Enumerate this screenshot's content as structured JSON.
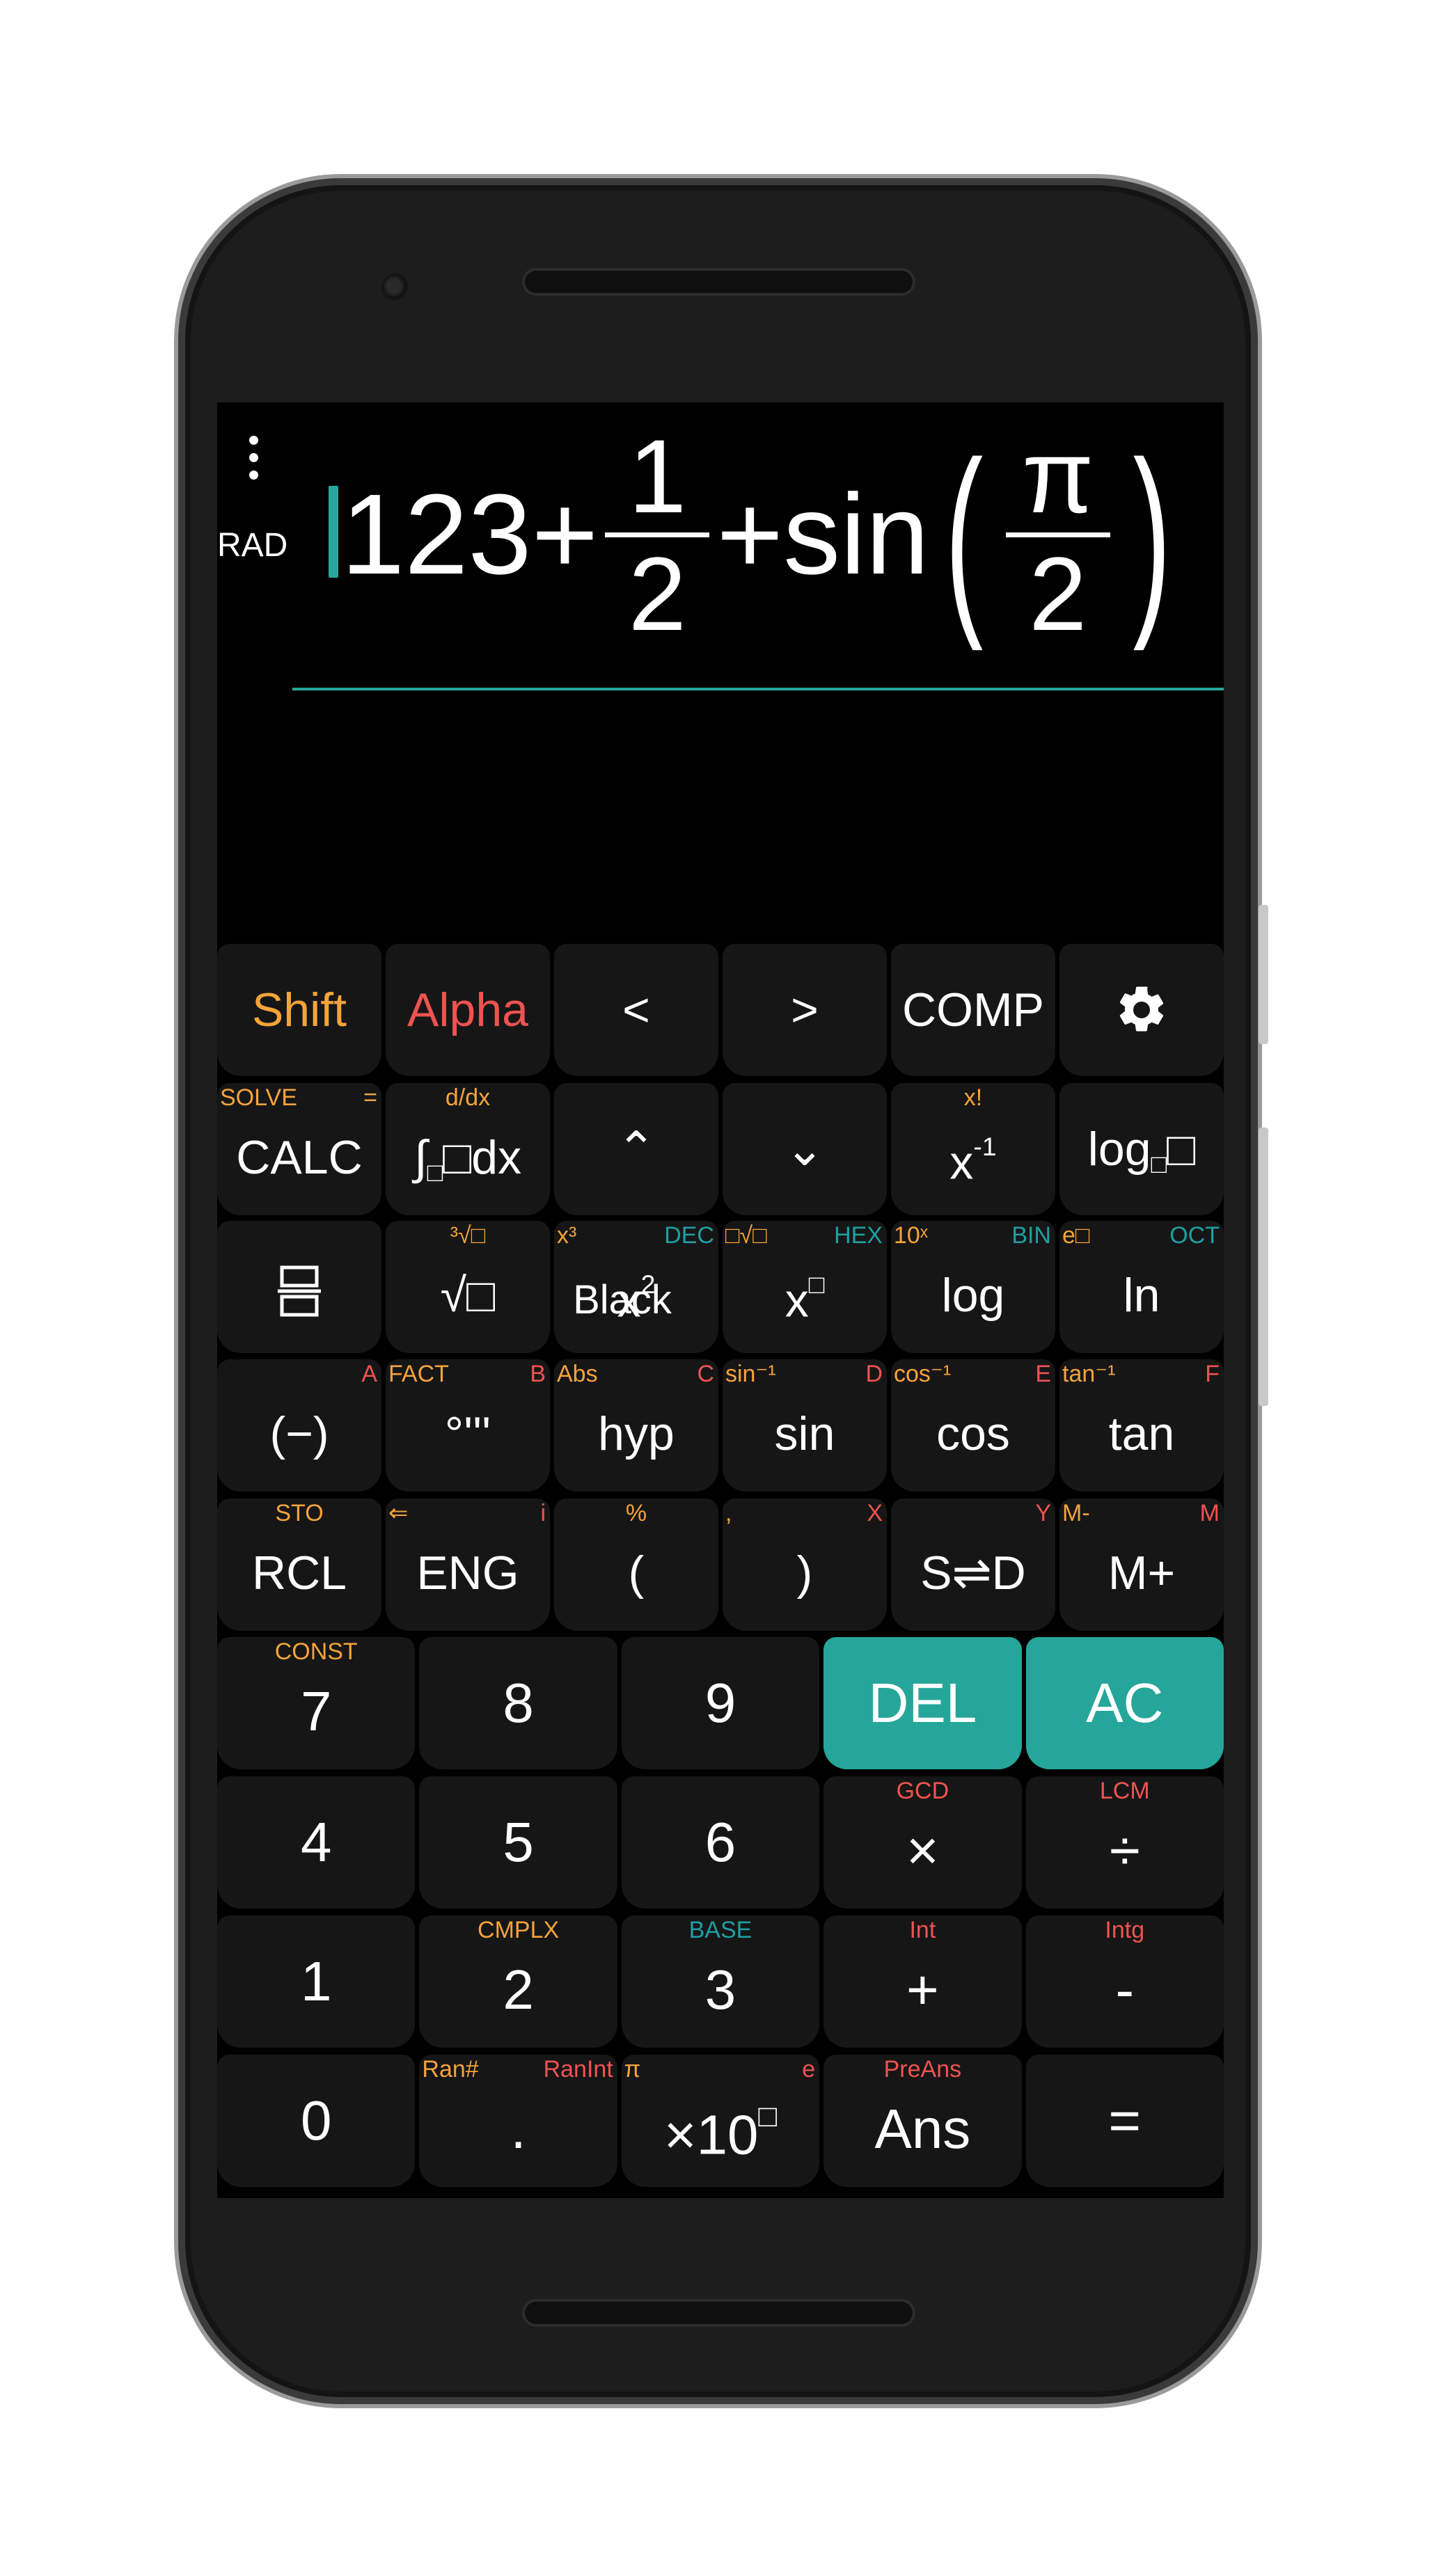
{
  "display": {
    "angle_mode": "RAD",
    "expr_prefix": "123+",
    "frac1_num": "1",
    "frac1_den": "2",
    "expr_mid": "+sin",
    "paren_open": "(",
    "frac2_num": "π",
    "frac2_den": "2",
    "paren_close": ")"
  },
  "row1": [
    {
      "main": "Shift",
      "color": "#f5a33b"
    },
    {
      "main": "Alpha",
      "color": "#ef5350"
    },
    {
      "main": "<"
    },
    {
      "main": ">"
    },
    {
      "main": "COMP"
    },
    {
      "icon": "gear-icon"
    }
  ],
  "row2": [
    {
      "main": "CALC",
      "sub_l": "SOLVE",
      "sub_r": "="
    },
    {
      "main_pre": "∫",
      "main_sub": "□",
      "main_post": "□dx",
      "sub_c": "d/dx"
    },
    {
      "main": "⌃"
    },
    {
      "main": "⌄"
    },
    {
      "main_base": "x",
      "main_sup": "-1",
      "sub_c": "x!"
    },
    {
      "main_pre": "log",
      "main_sub": "□",
      "main_post": "□"
    }
  ],
  "row3": [
    {
      "icon": "fraction-icon",
      "main": "⊟"
    },
    {
      "main": "√□",
      "sub_c": "³√□"
    },
    {
      "main_base": "x",
      "main_sup": "2",
      "sub_l": "x³",
      "sub_r": "DEC",
      "overlay": "Black"
    },
    {
      "main_base": "x",
      "main_sup": "□",
      "sub_l": "□√□",
      "sub_r": "HEX"
    },
    {
      "main": "log",
      "sub_l": "10ˣ",
      "sub_r": "BIN"
    },
    {
      "main": "ln",
      "sub_l": "e□",
      "sub_r": "OCT"
    }
  ],
  "row4": [
    {
      "main": "(−)",
      "sub_r": "A"
    },
    {
      "main": "°'''",
      "sub_l": "FACT",
      "sub_r": "B"
    },
    {
      "main": "hyp",
      "sub_l": "Abs",
      "sub_r": "C"
    },
    {
      "main": "sin",
      "sub_l": "sin⁻¹",
      "sub_r": "D"
    },
    {
      "main": "cos",
      "sub_l": "cos⁻¹",
      "sub_r": "E"
    },
    {
      "main": "tan",
      "sub_l": "tan⁻¹",
      "sub_r": "F"
    }
  ],
  "row5": [
    {
      "main": "RCL",
      "sub_c": "STO"
    },
    {
      "main": "ENG",
      "sub_l": "⇐",
      "sub_r": "i"
    },
    {
      "main": "(",
      "sub_c": "%"
    },
    {
      "main": ")",
      "sub_l": ",",
      "sub_r": "X"
    },
    {
      "main": "S⇌D",
      "sub_r": "Y"
    },
    {
      "main": "M+",
      "sub_l": "M-",
      "sub_r": "M"
    }
  ],
  "row6": [
    {
      "main": "7",
      "sub_c": "CONST"
    },
    {
      "main": "8"
    },
    {
      "main": "9"
    },
    {
      "main": "DEL"
    },
    {
      "main": "AC"
    }
  ],
  "row7": [
    {
      "main": "4"
    },
    {
      "main": "5"
    },
    {
      "main": "6"
    },
    {
      "main": "×",
      "sub_c": "GCD"
    },
    {
      "main": "÷",
      "sub_c": "LCM"
    }
  ],
  "row8": [
    {
      "main": "1"
    },
    {
      "main": "2",
      "sub_c": "CMPLX"
    },
    {
      "main": "3",
      "sub_c": "BASE"
    },
    {
      "main": "+",
      "sub_c": "Int"
    },
    {
      "main": "-",
      "sub_c": "Intg"
    }
  ],
  "row9": [
    {
      "main": "0"
    },
    {
      "main": ".",
      "sub_l": "Ran#",
      "sub_r": "RanInt"
    },
    {
      "main_base": "×10",
      "main_sup": "□",
      "sub_l": "π",
      "sub_r": "e"
    },
    {
      "main": "Ans",
      "sub_c": "PreAns"
    },
    {
      "main": "="
    }
  ],
  "colors": {
    "accent": "#26a69a",
    "shift": "#f5a33b",
    "alpha": "#ef5350",
    "teal_label": "#1e9fa3"
  }
}
